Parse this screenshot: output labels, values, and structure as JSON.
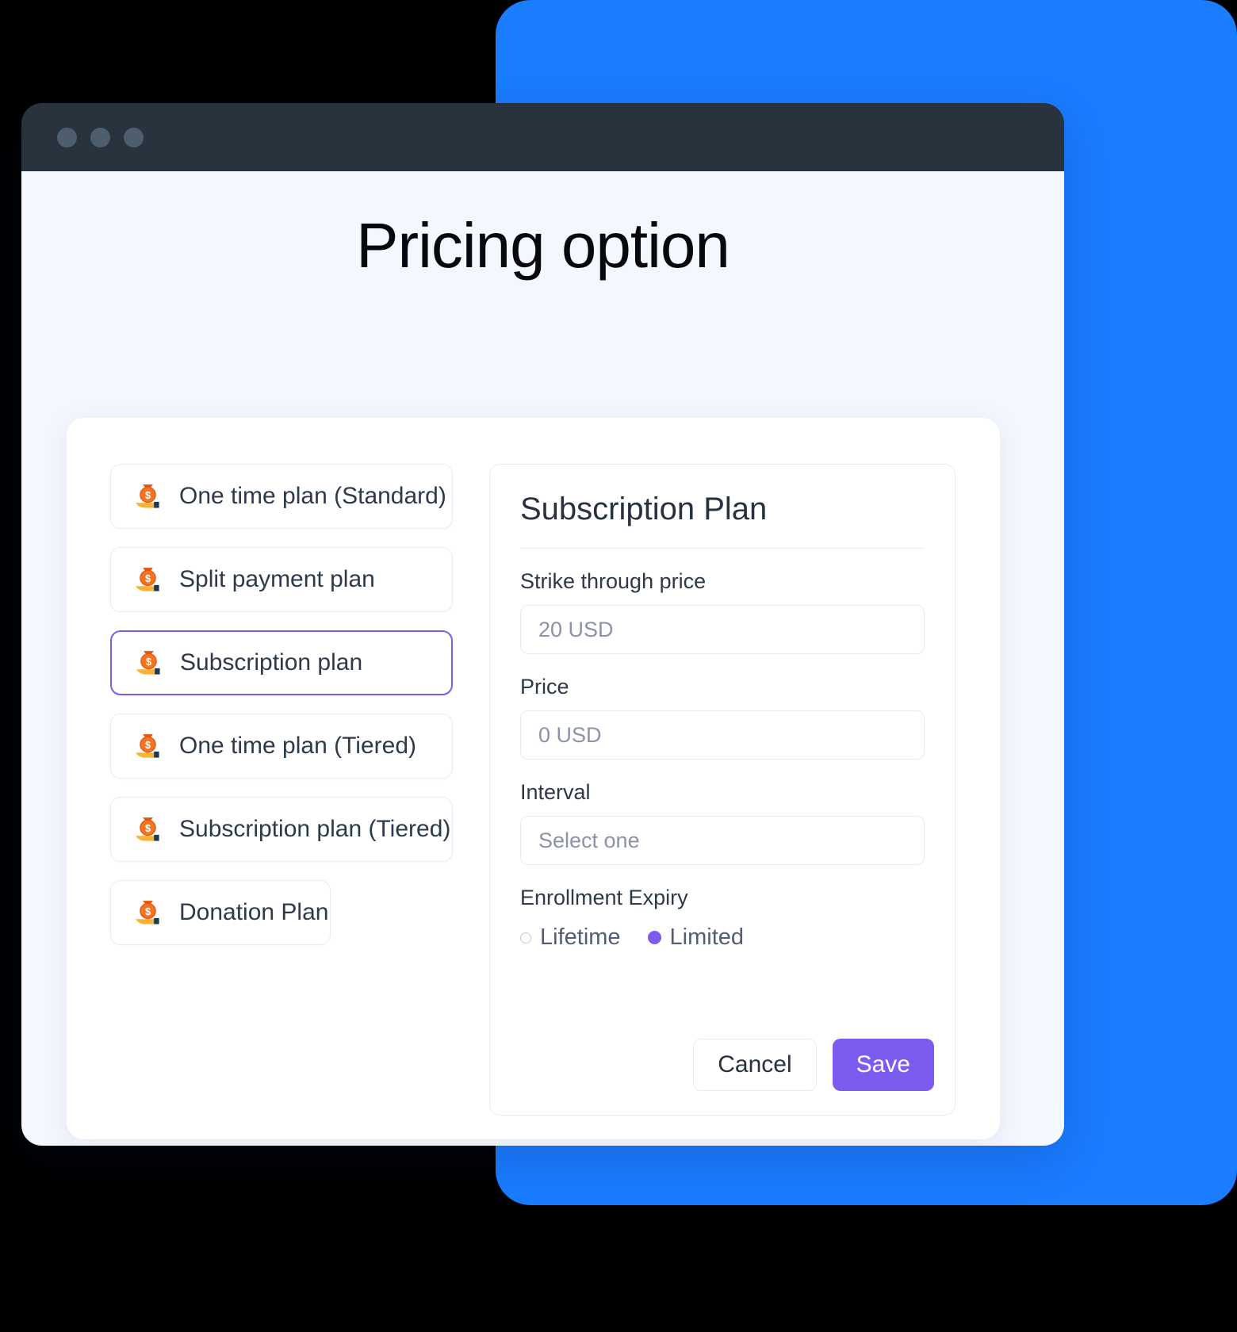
{
  "window": {
    "traffic_lights": [
      "close-dot",
      "minimize-dot",
      "maximize-dot"
    ]
  },
  "page": {
    "title": "Pricing option"
  },
  "plans": {
    "items": [
      {
        "label": "One time plan (Standard)",
        "icon": "money-bag-icon",
        "selected": false,
        "narrow": false
      },
      {
        "label": "Split payment plan",
        "icon": "money-bag-icon",
        "selected": false,
        "narrow": false
      },
      {
        "label": "Subscription plan",
        "icon": "money-bag-icon",
        "selected": true,
        "narrow": false
      },
      {
        "label": "One time plan (Tiered)",
        "icon": "money-bag-icon",
        "selected": false,
        "narrow": false
      },
      {
        "label": "Subscription plan (Tiered)",
        "icon": "money-bag-icon",
        "selected": false,
        "narrow": false
      },
      {
        "label": "Donation Plan",
        "icon": "money-bag-icon",
        "selected": false,
        "narrow": true
      }
    ]
  },
  "form": {
    "title": "Subscription Plan",
    "strike_price": {
      "label": "Strike through price",
      "placeholder": "20 USD",
      "value": ""
    },
    "price": {
      "label": "Price",
      "placeholder": "0 USD",
      "value": ""
    },
    "interval": {
      "label": "Interval",
      "placeholder": "Select one",
      "value": ""
    },
    "enrollment_expiry": {
      "label": "Enrollment Expiry",
      "options": [
        {
          "label": "Lifetime",
          "checked": false
        },
        {
          "label": "Limited",
          "checked": true
        }
      ]
    },
    "cancel_label": "Cancel",
    "save_label": "Save"
  },
  "colors": {
    "backdrop_blue": "#1A7CFF",
    "titlebar": "#28333D",
    "page_bg": "#F3F7FE",
    "accent_purple": "#7C5CF0",
    "text_dark": "#27313F",
    "text_muted": "#8C93A8",
    "border": "#E6EBF2"
  }
}
